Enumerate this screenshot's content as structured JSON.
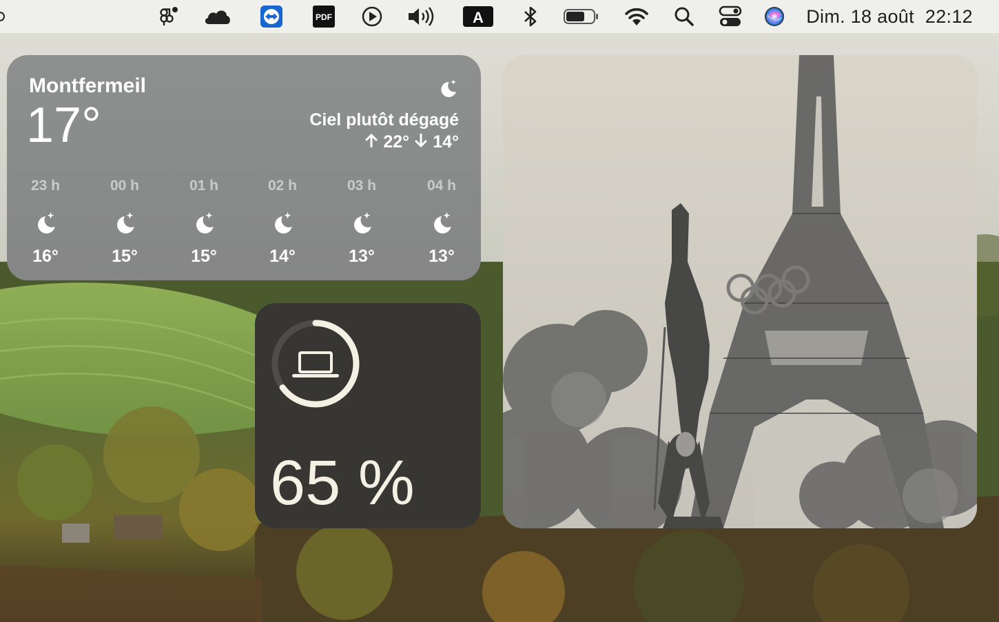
{
  "menubar": {
    "date": "Dim. 18 août",
    "time": "22:12",
    "icons": [
      "figma-icon",
      "cloud-icon",
      "teamviewer-icon",
      "pdf-icon",
      "play-icon",
      "volume-icon",
      "keyboard-input-icon",
      "bluetooth-icon",
      "battery-icon",
      "wifi-icon",
      "search-icon",
      "control-center-icon",
      "siri-icon"
    ],
    "pdf_label": "PDF",
    "input_label": "A"
  },
  "weather": {
    "city": "Montfermeil",
    "temperature": "17°",
    "condition": "Ciel plutôt dégagé",
    "high": "22°",
    "low": "14°",
    "hours": [
      {
        "label": "23 h",
        "temp": "16°",
        "icon": "moon-stars-icon"
      },
      {
        "label": "00 h",
        "temp": "15°",
        "icon": "moon-stars-icon"
      },
      {
        "label": "01 h",
        "temp": "15°",
        "icon": "moon-stars-icon"
      },
      {
        "label": "02 h",
        "temp": "14°",
        "icon": "moon-stars-icon"
      },
      {
        "label": "03 h",
        "temp": "13°",
        "icon": "moon-stars-icon"
      },
      {
        "label": "04 h",
        "temp": "13°",
        "icon": "moon-stars-icon"
      }
    ]
  },
  "battery": {
    "percent_text": "65 %",
    "level": 0.65,
    "device_icon": "laptop-icon"
  },
  "colors": {
    "menubar_bg": "#efefeb",
    "weather_bg": "#8b8d8d",
    "battery_bg": "#373633",
    "battery_ring": "#f4f1e4"
  }
}
